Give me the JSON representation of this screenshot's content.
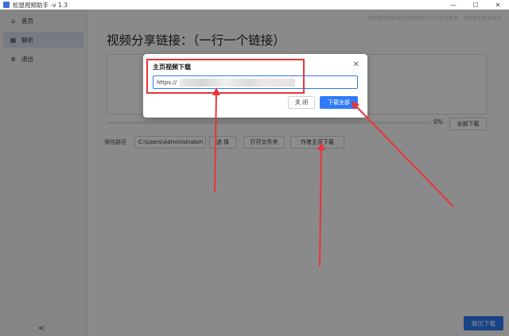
{
  "window": {
    "title": "松鼠视频助手 -v 1.3",
    "controls": [
      "—",
      "☐",
      "✕"
    ]
  },
  "sidebar": {
    "items": [
      {
        "label": "首页",
        "icon": "home-icon",
        "glyph": "⌂"
      },
      {
        "label": "解析",
        "icon": "grid-icon",
        "glyph": "▦"
      },
      {
        "label": "退出",
        "icon": "exit-icon",
        "glyph": "⊗"
      }
    ],
    "collapse_glyph": "<"
  },
  "main": {
    "hint": "所有视频均来自互联网仅作为学习交流使用，请勿用于商业用途",
    "title": "视频分享链接：（一行一个链接）",
    "progress_fraction": 0,
    "percent": "0%",
    "download_all_label": "全部下载",
    "save_label": "保存路径",
    "path_value": "C:\\Users\\Administrator\\",
    "choose_label": "选 择",
    "open_folder_label": "打开文件夹",
    "author_download_label": "作者主页下载",
    "bottom_button": "解压下载"
  },
  "dialog": {
    "title": "主页视频下载",
    "close_glyph": "✕",
    "input_value": "https://",
    "close_button": "关 闭",
    "download_all_button": "下载全部"
  },
  "colors": {
    "accent": "#2f7bf6",
    "annotation": "#e8353a"
  }
}
